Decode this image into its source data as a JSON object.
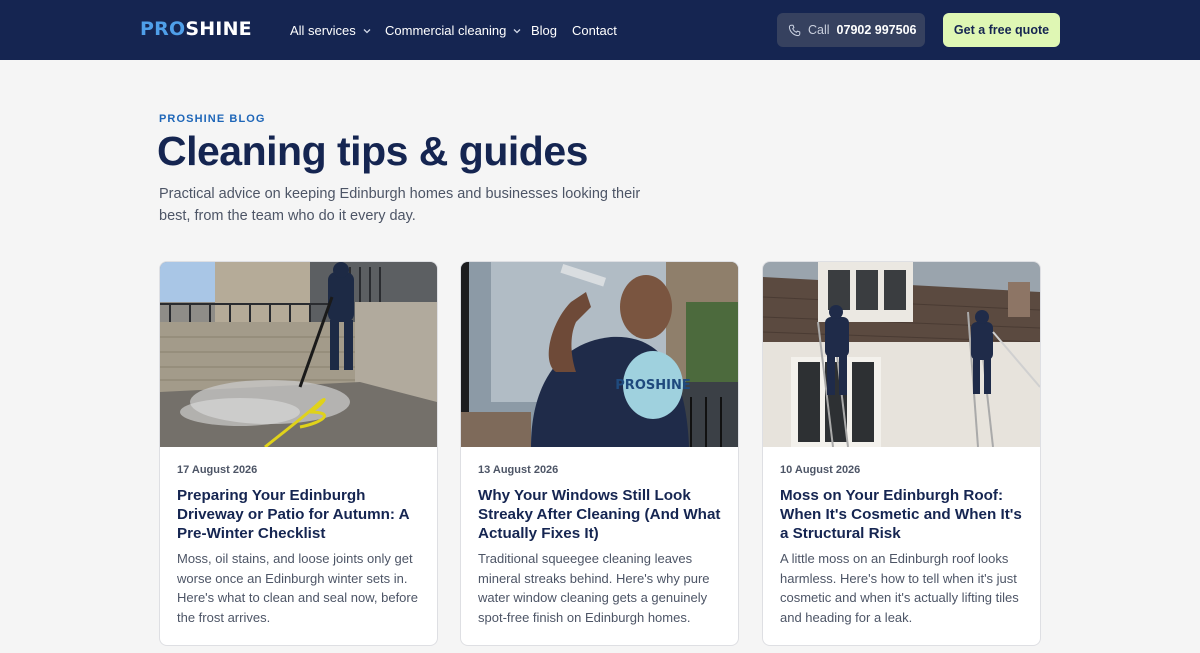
{
  "header": {
    "logo_pro": "PRO",
    "logo_shine": "SHINE",
    "nav": [
      {
        "label": "All services",
        "dropdown": true
      },
      {
        "label": "Commercial cleaning",
        "dropdown": true
      },
      {
        "label": "Blog",
        "dropdown": false
      },
      {
        "label": "Contact",
        "dropdown": false
      }
    ],
    "call_label": "Call",
    "call_number": "07902 997506",
    "quote_label": "Get a free quote"
  },
  "hero": {
    "eyebrow": "PROSHINE BLOG",
    "title": "Cleaning tips & guides",
    "intro": "Practical advice on keeping Edinburgh homes and businesses looking their best, from the team who do it every day."
  },
  "posts": [
    {
      "date": "17 August 2026",
      "title": "Preparing Your Edinburgh Driveway or Patio for Autumn: A Pre-Winter Checklist",
      "excerpt": "Moss, oil stains, and loose joints only get worse once an Edinburgh winter sets in. Here's what to clean and seal now, before the frost arrives.",
      "image": "pressure-washing-patio-photo"
    },
    {
      "date": "13 August 2026",
      "title": "Why Your Windows Still Look Streaky After Cleaning (And What Actually Fixes It)",
      "excerpt": "Traditional squeegee cleaning leaves mineral streaks behind. Here's why pure water window cleaning gets a genuinely spot-free finish on Edinburgh homes.",
      "image": "window-cleaning-photo",
      "image_logo_text": "PROSHINE"
    },
    {
      "date": "10 August 2026",
      "title": "Moss on Your Edinburgh Roof: When It's Cosmetic and When It's a Structural Risk",
      "excerpt": "A little moss on an Edinburgh roof looks harmless. Here's how to tell when it's just cosmetic and when it's actually lifting tiles and heading for a leak.",
      "image": "roof-moss-cleaning-photo"
    }
  ],
  "colors": {
    "header_bg": "#152551",
    "accent_blue": "#4f9fe9",
    "quote_bg": "#dff7b4",
    "eyebrow": "#1e66b8"
  }
}
